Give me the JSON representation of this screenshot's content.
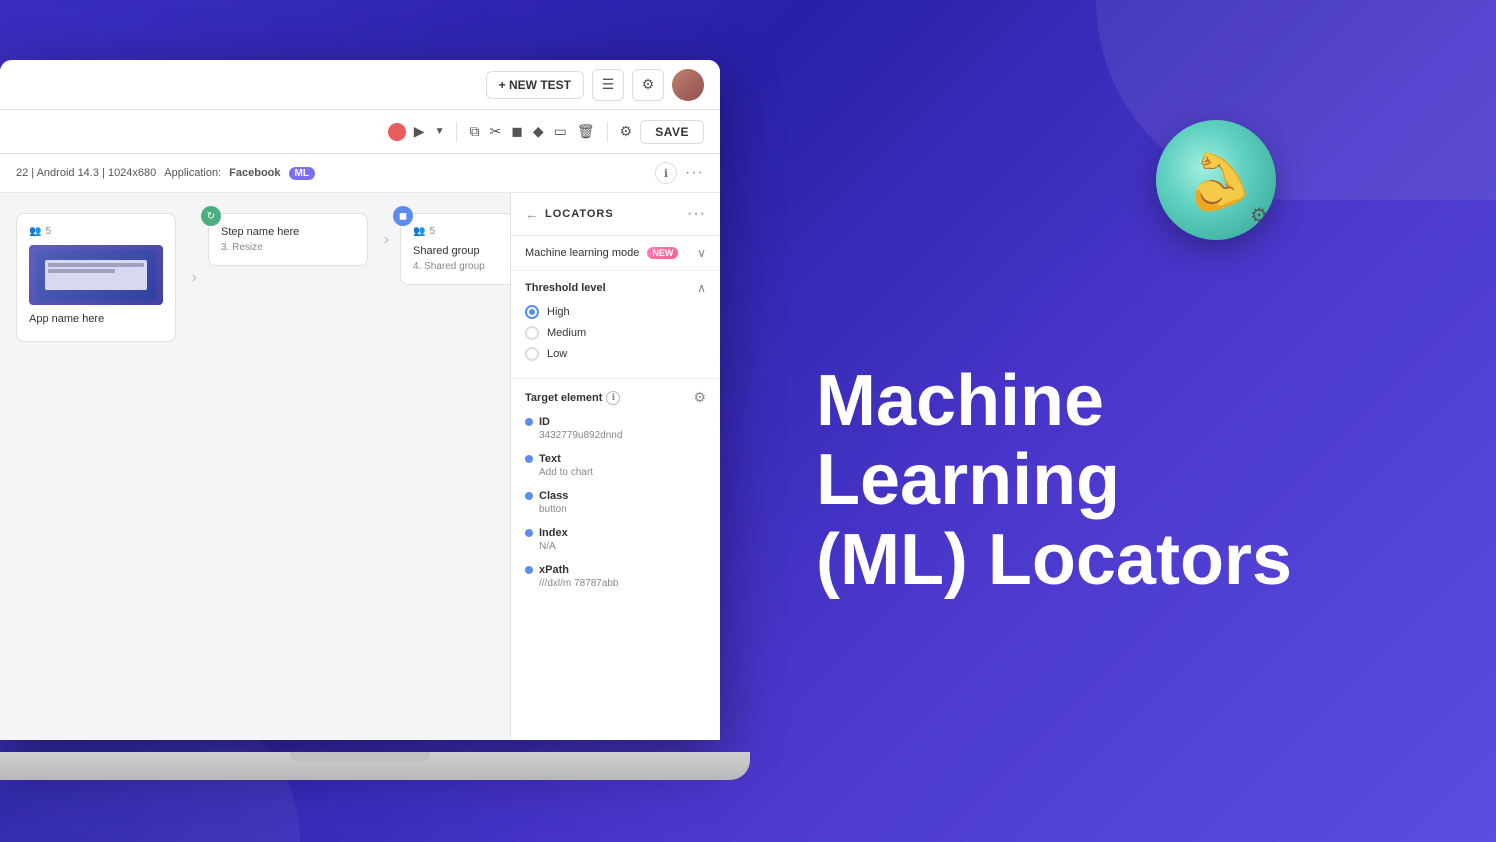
{
  "background": {
    "gradient_start": "#3a2dbf",
    "gradient_end": "#5b4de0"
  },
  "toolbar_top": {
    "new_test_label": "+ NEW TEST",
    "save_label": "SAVE",
    "icons": [
      "document",
      "settings",
      "avatar"
    ]
  },
  "toolbar_second": {
    "record_label": "●",
    "play_label": "▶",
    "icons": [
      "copy",
      "cut",
      "stop",
      "shield",
      "crop",
      "trash",
      "gear"
    ]
  },
  "info_bar": {
    "device_info": "22 | Android 14.3 | 1024x680",
    "app_label": "Application:",
    "app_name": "Facebook",
    "ml_badge": "ML"
  },
  "steps": [
    {
      "id": "step-1",
      "title": "App name here",
      "subtitle": "",
      "badge_count": "5",
      "dot_type": "thumbnail",
      "has_arrow": true
    },
    {
      "id": "step-2",
      "title": "Step name here",
      "subtitle": "3. Resize",
      "badge_count": "",
      "dot_type": "green",
      "has_arrow": true
    },
    {
      "id": "step-3",
      "title": "Shared group",
      "subtitle": "4. Shared group",
      "badge_count": "5",
      "dot_type": "blue",
      "has_arrow": false
    }
  ],
  "locators": {
    "title": "LOCATORS",
    "back_icon": "←",
    "more_icon": "···",
    "ml_mode": {
      "label": "Machine learning mode",
      "badge": "NEW",
      "expanded": true
    },
    "threshold": {
      "label": "Threshold level",
      "expanded": true,
      "options": [
        {
          "label": "High",
          "selected": true
        },
        {
          "label": "Medium",
          "selected": false
        },
        {
          "label": "Low",
          "selected": false
        }
      ]
    },
    "target_element": {
      "label": "Target element",
      "items": [
        {
          "name": "ID",
          "value": "3432779u892dnnd"
        },
        {
          "name": "Text",
          "value": "Add to chart"
        },
        {
          "name": "Class",
          "value": "button"
        },
        {
          "name": "Index",
          "value": "N/A"
        },
        {
          "name": "xPath",
          "value": "///dxl/m 78787abb"
        }
      ]
    }
  },
  "right_panel": {
    "title_line1": "Machine Learning",
    "title_line2": "(ML) Locators"
  }
}
